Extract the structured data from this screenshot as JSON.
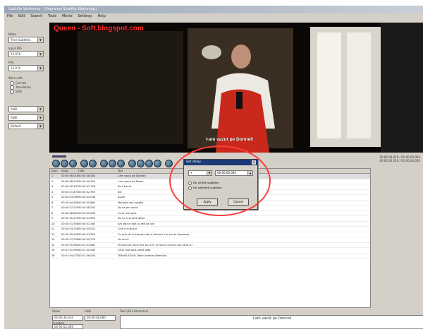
{
  "window": {
    "title": "Subtitle Workshop - [Sopranos Subtitle Workshop]"
  },
  "menu": [
    "File",
    "Edit",
    "Search",
    "Tools",
    "Movie",
    "Settings",
    "Help"
  ],
  "left_panel": {
    "mode_label": "Mode",
    "mode_value": "Time Subtitles",
    "input_fps_label": "Input FPS",
    "input_fps_value": "23.976",
    "fps_label": "FPS",
    "fps_value": "23.976",
    "work_with_label": "Work with",
    "radios": [
      "Current",
      "Translation",
      "Both"
    ],
    "combo1": "ANSI",
    "combo2": "ANSI",
    "combo3": "Default"
  },
  "video": {
    "watermark": "Queen - Soft.blogspot.com",
    "subtitle": "I-am vazut pe Donnell"
  },
  "player": {
    "time_line1": "00:00:36,016 / 01:00:04,004",
    "time_line2": "00:00:36,016 / 01:00:04,004"
  },
  "table": {
    "columns": [
      "Num",
      "Show",
      "Hide",
      "Text"
    ],
    "rows": [
      [
        "1",
        "00:00:36,016",
        "00:00:38,085",
        "I-am vazut pe Donnell"
      ],
      [
        "2",
        "00:00:38,255",
        "00:00:40,320",
        "I-am vazut pe Meaw"
      ],
      [
        "3",
        "00:00:40,397",
        "00:00:41,758",
        "Pe a trecut"
      ],
      [
        "4",
        "00:00:41,870",
        "00:00:42,955",
        "Bill"
      ],
      [
        "5",
        "00:00:43,089",
        "00:00:44,048",
        "Super"
      ],
      [
        "6",
        "00:00:44,909",
        "00:00:45,860",
        "Mamma non sveglia"
      ],
      [
        "7",
        "00:00:47,525",
        "00:00:48,502",
        "Nu ne-am vazut"
      ],
      [
        "8",
        "00:00:48,854",
        "00:00:49,630",
        "Ce-ai mai spus"
      ],
      [
        "9",
        "00:00:50,275",
        "00:00:51,850",
        "Nu tu m-ai bine deloc"
      ],
      [
        "10",
        "00:00:51,958",
        "00:00:53,385",
        "Am stat in fata lui fed de luni"
      ],
      [
        "11",
        "00:00:53,703",
        "00:00:55,001",
        "Cine e la Bucur"
      ],
      [
        "12",
        "00:00:55,503",
        "00:00:57,859",
        "Cu ochi de inchisoare de la vitrina lui la ore de Sopranos"
      ],
      [
        "13",
        "00:00:57,926",
        "00:00:59,278",
        "Nu te-mi"
      ],
      [
        "14",
        "00:00:59,362",
        "00:01:01,863",
        "Pronunt pe mine mai rau e in un semn cont ce pai cand nu"
      ],
      [
        "15",
        "00:01:01,994",
        "00:01:04,083",
        "Ce-ai mai spus vazut asta"
      ],
      [
        "16",
        "00:01:04,073",
        "00:01:06,004",
        "TRANSLATION: Team Intrarea Romania"
      ]
    ]
  },
  "bottom": {
    "show_label": "Show",
    "hide_label": "Hide",
    "show_value": "00:00:36,016",
    "hide_value": "00:00:38,085",
    "duration_label": "Duration",
    "duration_value": "00:00:02,069",
    "text_label": "Text (16 characters)",
    "text_value": "I-am vazut pe Donnell"
  },
  "dialog": {
    "title": "Set delay",
    "sign_value": "+",
    "delay_value": "00:00:00,000",
    "option_all": "For all the subtitles",
    "option_selected": "For selected subtitles",
    "apply_label": "Apply",
    "cancel_label": "Cancel"
  },
  "colors": {
    "annotation": "#ff3b3b",
    "watermark": "#ff2a2a",
    "dialog_title": "#1a3a78"
  }
}
